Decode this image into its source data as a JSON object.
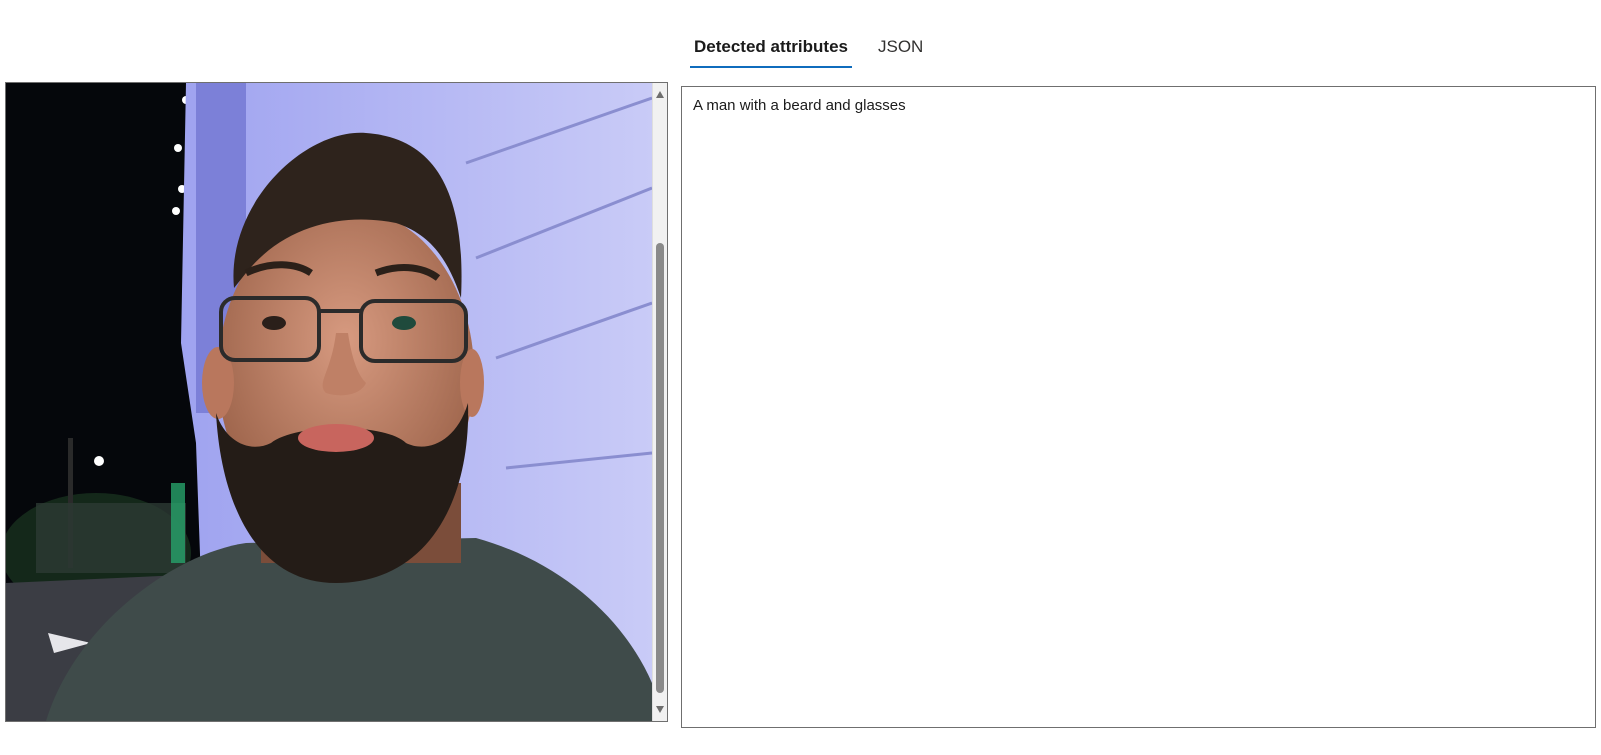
{
  "tabs": [
    {
      "label": "Detected attributes",
      "active": true
    },
    {
      "label": "JSON",
      "active": false
    }
  ],
  "result": {
    "text": "A man with a beard and glasses"
  },
  "colors": {
    "accent": "#0f6cbd",
    "border": "#6f6f6f"
  },
  "icons": {
    "scroll_up": "triangle-up",
    "scroll_down": "triangle-down"
  }
}
